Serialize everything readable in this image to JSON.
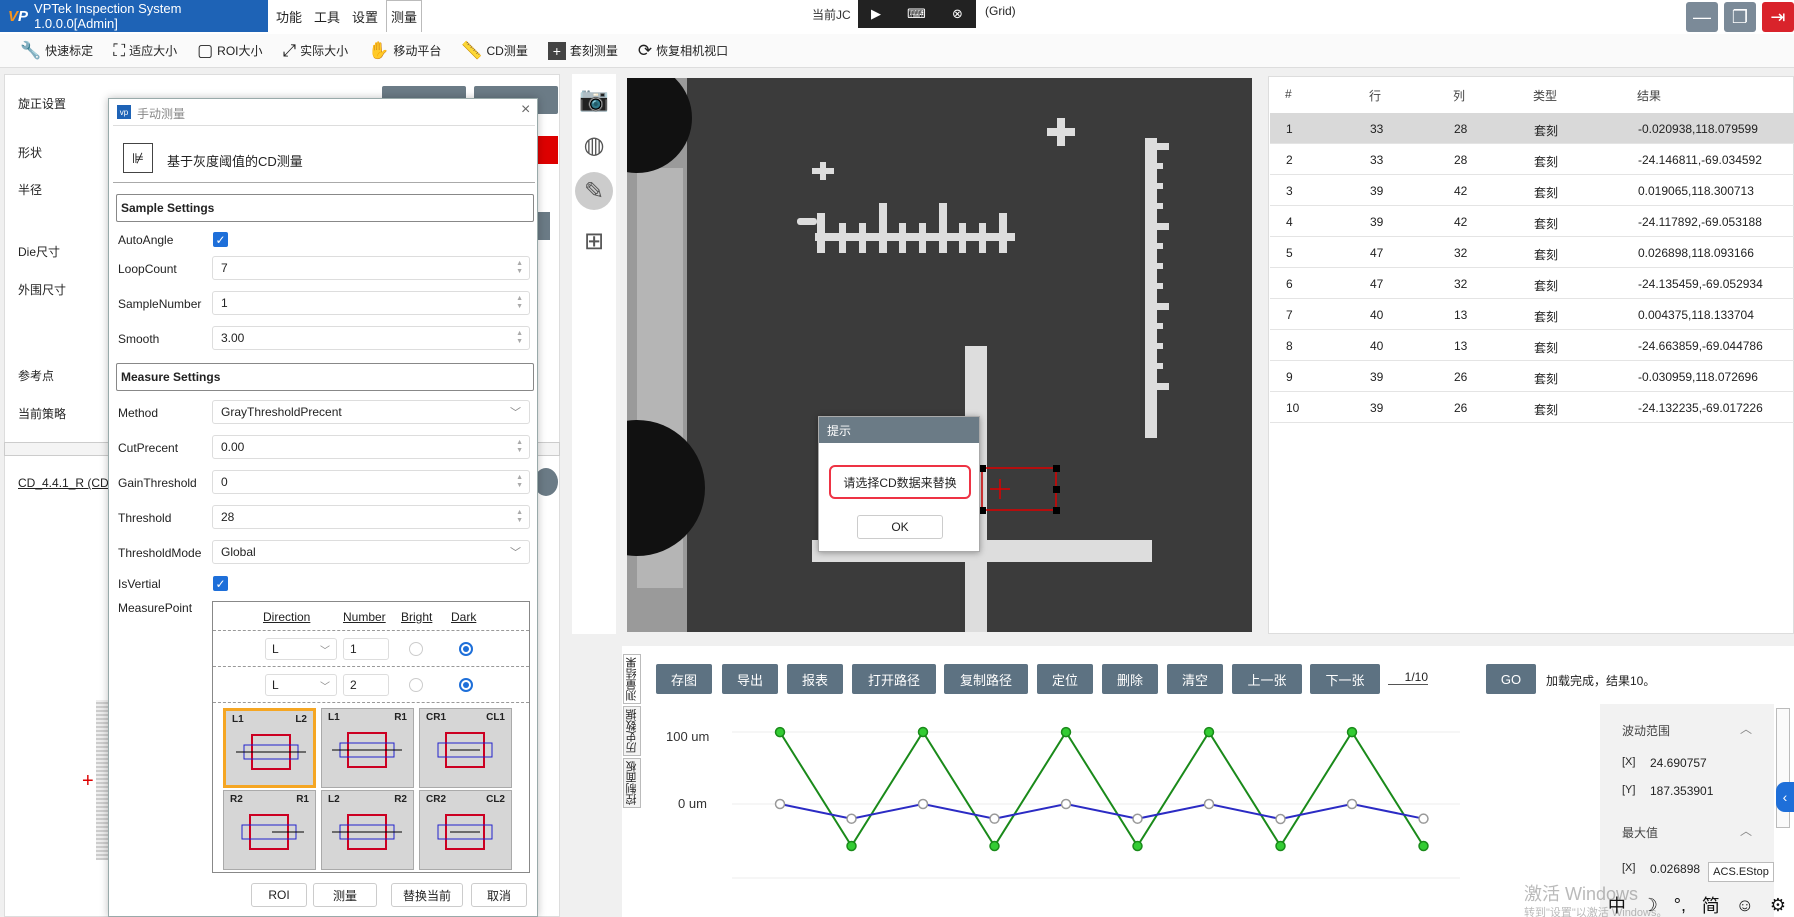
{
  "app": {
    "title": "VPTek Inspection System 1.0.0.0[Admin]",
    "logo": "VP"
  },
  "menus": [
    "功能",
    "工具",
    "设置",
    "测量"
  ],
  "center": {
    "left": "当前JC",
    "right": "(Grid)"
  },
  "toolbar": [
    "快速标定",
    "适应大小",
    "ROI大小",
    "实际大小",
    "移动平台",
    "CD测量",
    "套刻测量",
    "恢复相机视口"
  ],
  "left": {
    "labels": [
      "旋正设置",
      "形状",
      "半径",
      "Die尺寸",
      "外围尺寸",
      "参考点",
      "当前策略"
    ],
    "cd_link": "CD_4.4.1_R (CD)"
  },
  "dialog": {
    "title": "手动测量",
    "logo": "vp",
    "heading": "基于灰度阈值的CD测量",
    "sample_title": "Sample Settings",
    "autoangle": "AutoAngle",
    "loopcount": "LoopCount",
    "loopcount_val": "7",
    "samplenumber": "SampleNumber",
    "samplenumber_val": "1",
    "smooth": "Smooth",
    "smooth_val": "3.00",
    "measure_title": "Measure Settings",
    "method": "Method",
    "method_val": "GrayThresholdPrecent",
    "cutprecent": "CutPrecent",
    "cutprecent_val": "0.00",
    "gainthreshold": "GainThreshold",
    "gainthreshold_val": "0",
    "threshold": "Threshold",
    "threshold_val": "28",
    "thresholdmode": "ThresholdMode",
    "thresholdmode_val": "Global",
    "isvertial": "IsVertial",
    "measurepoint": "MeasurePoint",
    "mp_headers": [
      "Direction",
      "Number",
      "Bright",
      "Dark"
    ],
    "mp_rows": [
      {
        "dir": "L",
        "num": "1"
      },
      {
        "dir": "L",
        "num": "2"
      }
    ],
    "modes": [
      [
        "L1",
        "L2"
      ],
      [
        "L1",
        "R1"
      ],
      [
        "CR1",
        "CL1"
      ],
      [
        "R2",
        "R1"
      ],
      [
        "L2",
        "R2"
      ],
      [
        "CR2",
        "CL2"
      ]
    ],
    "buttons": [
      "ROI",
      "测量",
      "替换当前",
      "取消"
    ]
  },
  "prompt": {
    "title": "提示",
    "message": "请选择CD数据来替换",
    "ok": "OK"
  },
  "table": {
    "headers": [
      "#",
      "行",
      "列",
      "类型",
      "结果"
    ],
    "rows": [
      [
        "1",
        "33",
        "28",
        "套刻",
        "-0.020938,118.079599"
      ],
      [
        "2",
        "33",
        "28",
        "套刻",
        "-24.146811,-69.034592"
      ],
      [
        "3",
        "39",
        "42",
        "套刻",
        "0.019065,118.300713"
      ],
      [
        "4",
        "39",
        "42",
        "套刻",
        "-24.117892,-69.053188"
      ],
      [
        "5",
        "47",
        "32",
        "套刻",
        "0.026898,118.093166"
      ],
      [
        "6",
        "47",
        "32",
        "套刻",
        "-24.135459,-69.052934"
      ],
      [
        "7",
        "40",
        "13",
        "套刻",
        "0.004375,118.133704"
      ],
      [
        "8",
        "40",
        "13",
        "套刻",
        "-24.663859,-69.044786"
      ],
      [
        "9",
        "39",
        "26",
        "套刻",
        "-0.030959,118.072696"
      ],
      [
        "10",
        "39",
        "26",
        "套刻",
        "-24.132235,-69.017226"
      ]
    ]
  },
  "actions": [
    "存图",
    "导出",
    "报表",
    "打开路径",
    "复制路径",
    "定位",
    "删除",
    "清空",
    "上一张",
    "下一张"
  ],
  "page": "1/10",
  "go": "GO",
  "status": "加载完成，结果10。",
  "vtabs": [
    "测量结果",
    "历史数据",
    "控制面板"
  ],
  "stats": {
    "range_title": "波动范围",
    "range_x": "24.690757",
    "range_y": "187.353901",
    "max_title": "最大值",
    "max_x": "0.026898",
    "x": "[X]",
    "y": "[Y]"
  },
  "chart_data": {
    "type": "line",
    "yticks": [
      "100 um",
      "0 um"
    ],
    "series": [
      {
        "color": "#1a8a1a",
        "values": [
          118.08,
          -69.03,
          118.3,
          -69.05,
          118.09,
          -69.05,
          118.13,
          -69.04,
          118.07,
          -69.02
        ]
      },
      {
        "color": "#2b2bc4",
        "values": [
          -0.02,
          -24.15,
          0.02,
          -24.12,
          0.03,
          -24.14,
          0.0,
          -24.66,
          -0.03,
          -24.13
        ]
      }
    ]
  },
  "acs": "ACS.EStop",
  "watermark": "激活 Windows",
  "watermark_sub": "转到\"设置\"以激活 Windows。",
  "tray": [
    "中",
    "☽",
    "°,",
    "简",
    "☺",
    "⚙"
  ]
}
